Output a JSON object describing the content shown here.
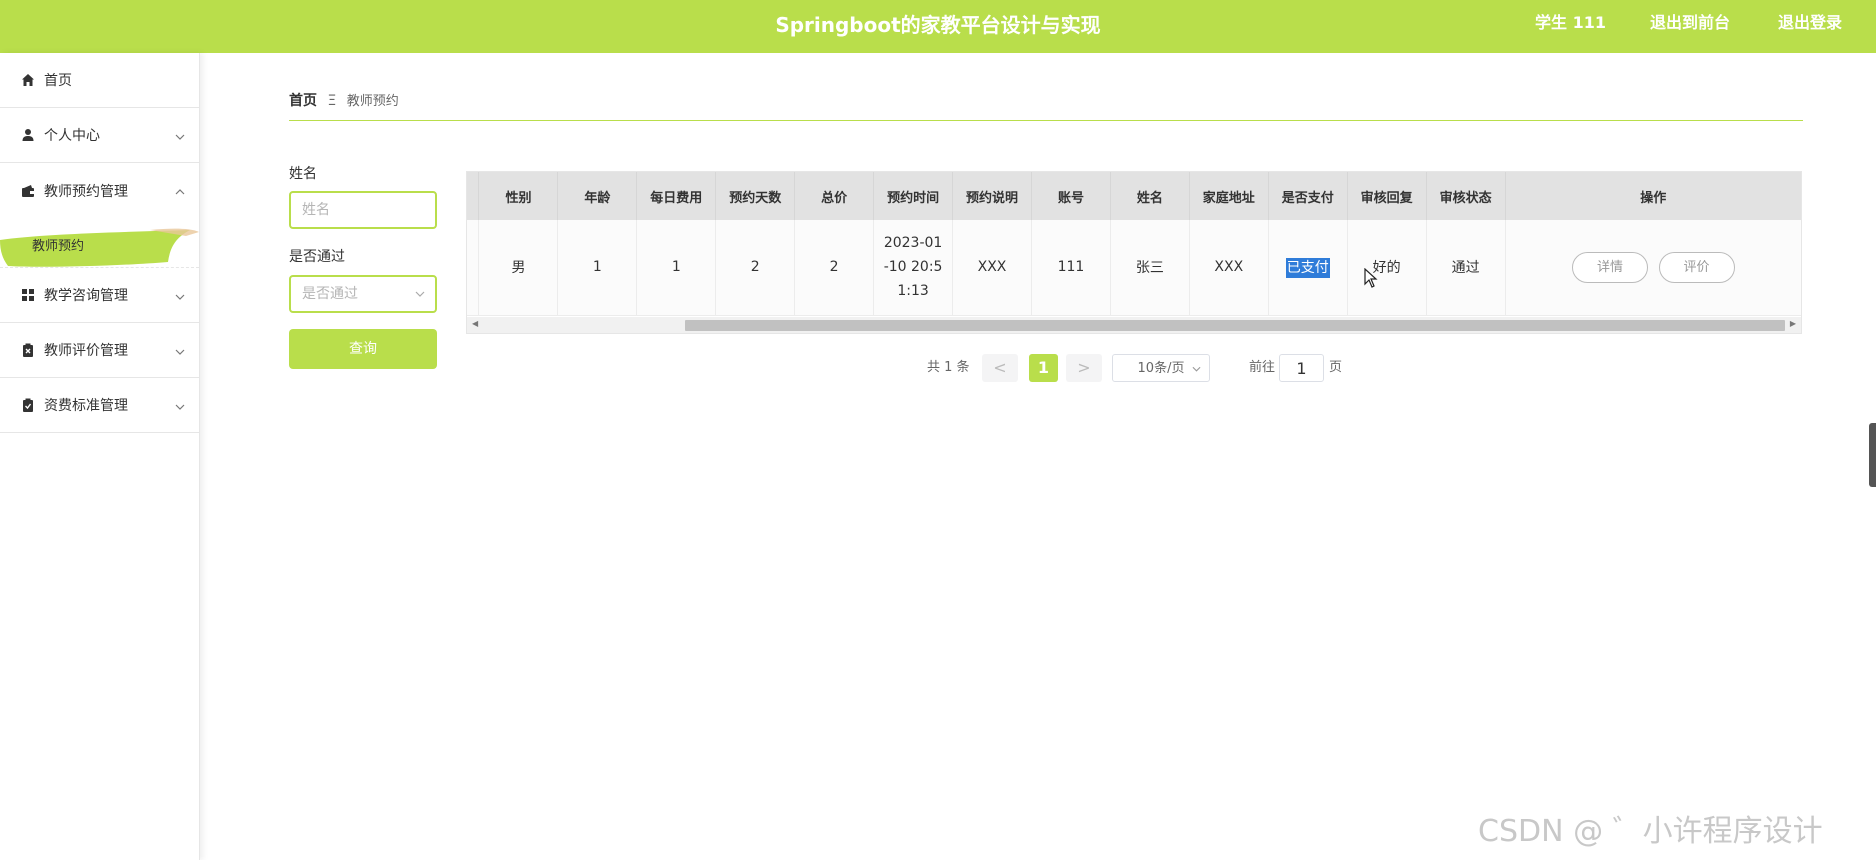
{
  "header": {
    "title": "Springboot的家教平台设计与实现",
    "user_label": "学生 111",
    "back_label": "退出到前台",
    "logout_label": "退出登录",
    "accent_color": "#b9de4b"
  },
  "sidebar": {
    "items": [
      {
        "label": "首页",
        "icon": "home-icon"
      },
      {
        "label": "个人中心",
        "icon": "person-icon"
      },
      {
        "label": "教师预约管理",
        "icon": "wallet-icon"
      },
      {
        "label": "教学咨询管理",
        "icon": "grid-icon"
      },
      {
        "label": "教师评价管理",
        "icon": "clipboard-x-icon"
      },
      {
        "label": "资费标准管理",
        "icon": "clipboard-check-icon"
      }
    ],
    "active_sub": "教师预约"
  },
  "breadcrumb": {
    "home": "首页",
    "separator": "Ξ",
    "current": "教师预约"
  },
  "search": {
    "name_label": "姓名",
    "name_placeholder": "姓名",
    "pass_label": "是否通过",
    "pass_placeholder": "是否通过",
    "query_button": "查询"
  },
  "table": {
    "headers": [
      "性别",
      "年龄",
      "每日费用",
      "预约天数",
      "总价",
      "预约时间",
      "预约说明",
      "账号",
      "姓名",
      "家庭地址",
      "是否支付",
      "审核回复",
      "审核状态",
      "操作"
    ],
    "rows": [
      {
        "gender": "男",
        "age": "1",
        "daily_fee": "1",
        "days": "2",
        "total": "2",
        "time_line1": "2023-01",
        "time_line2": "-10 20:5",
        "time_line3": "1:13",
        "note": "XXX",
        "account": "111",
        "name": "张三",
        "address": "XXX",
        "paid": "已支付",
        "reply": "好的",
        "status": "通过",
        "detail_btn": "详情",
        "review_btn": "评价"
      }
    ]
  },
  "pagination": {
    "total": "共 1 条",
    "prev": "<",
    "current_page": "1",
    "next": ">",
    "page_size": "10条/页",
    "goto_label": "前往",
    "goto_value": "1",
    "page_suffix": "页"
  },
  "watermark": "CSDN @ ゛小许程序设计"
}
